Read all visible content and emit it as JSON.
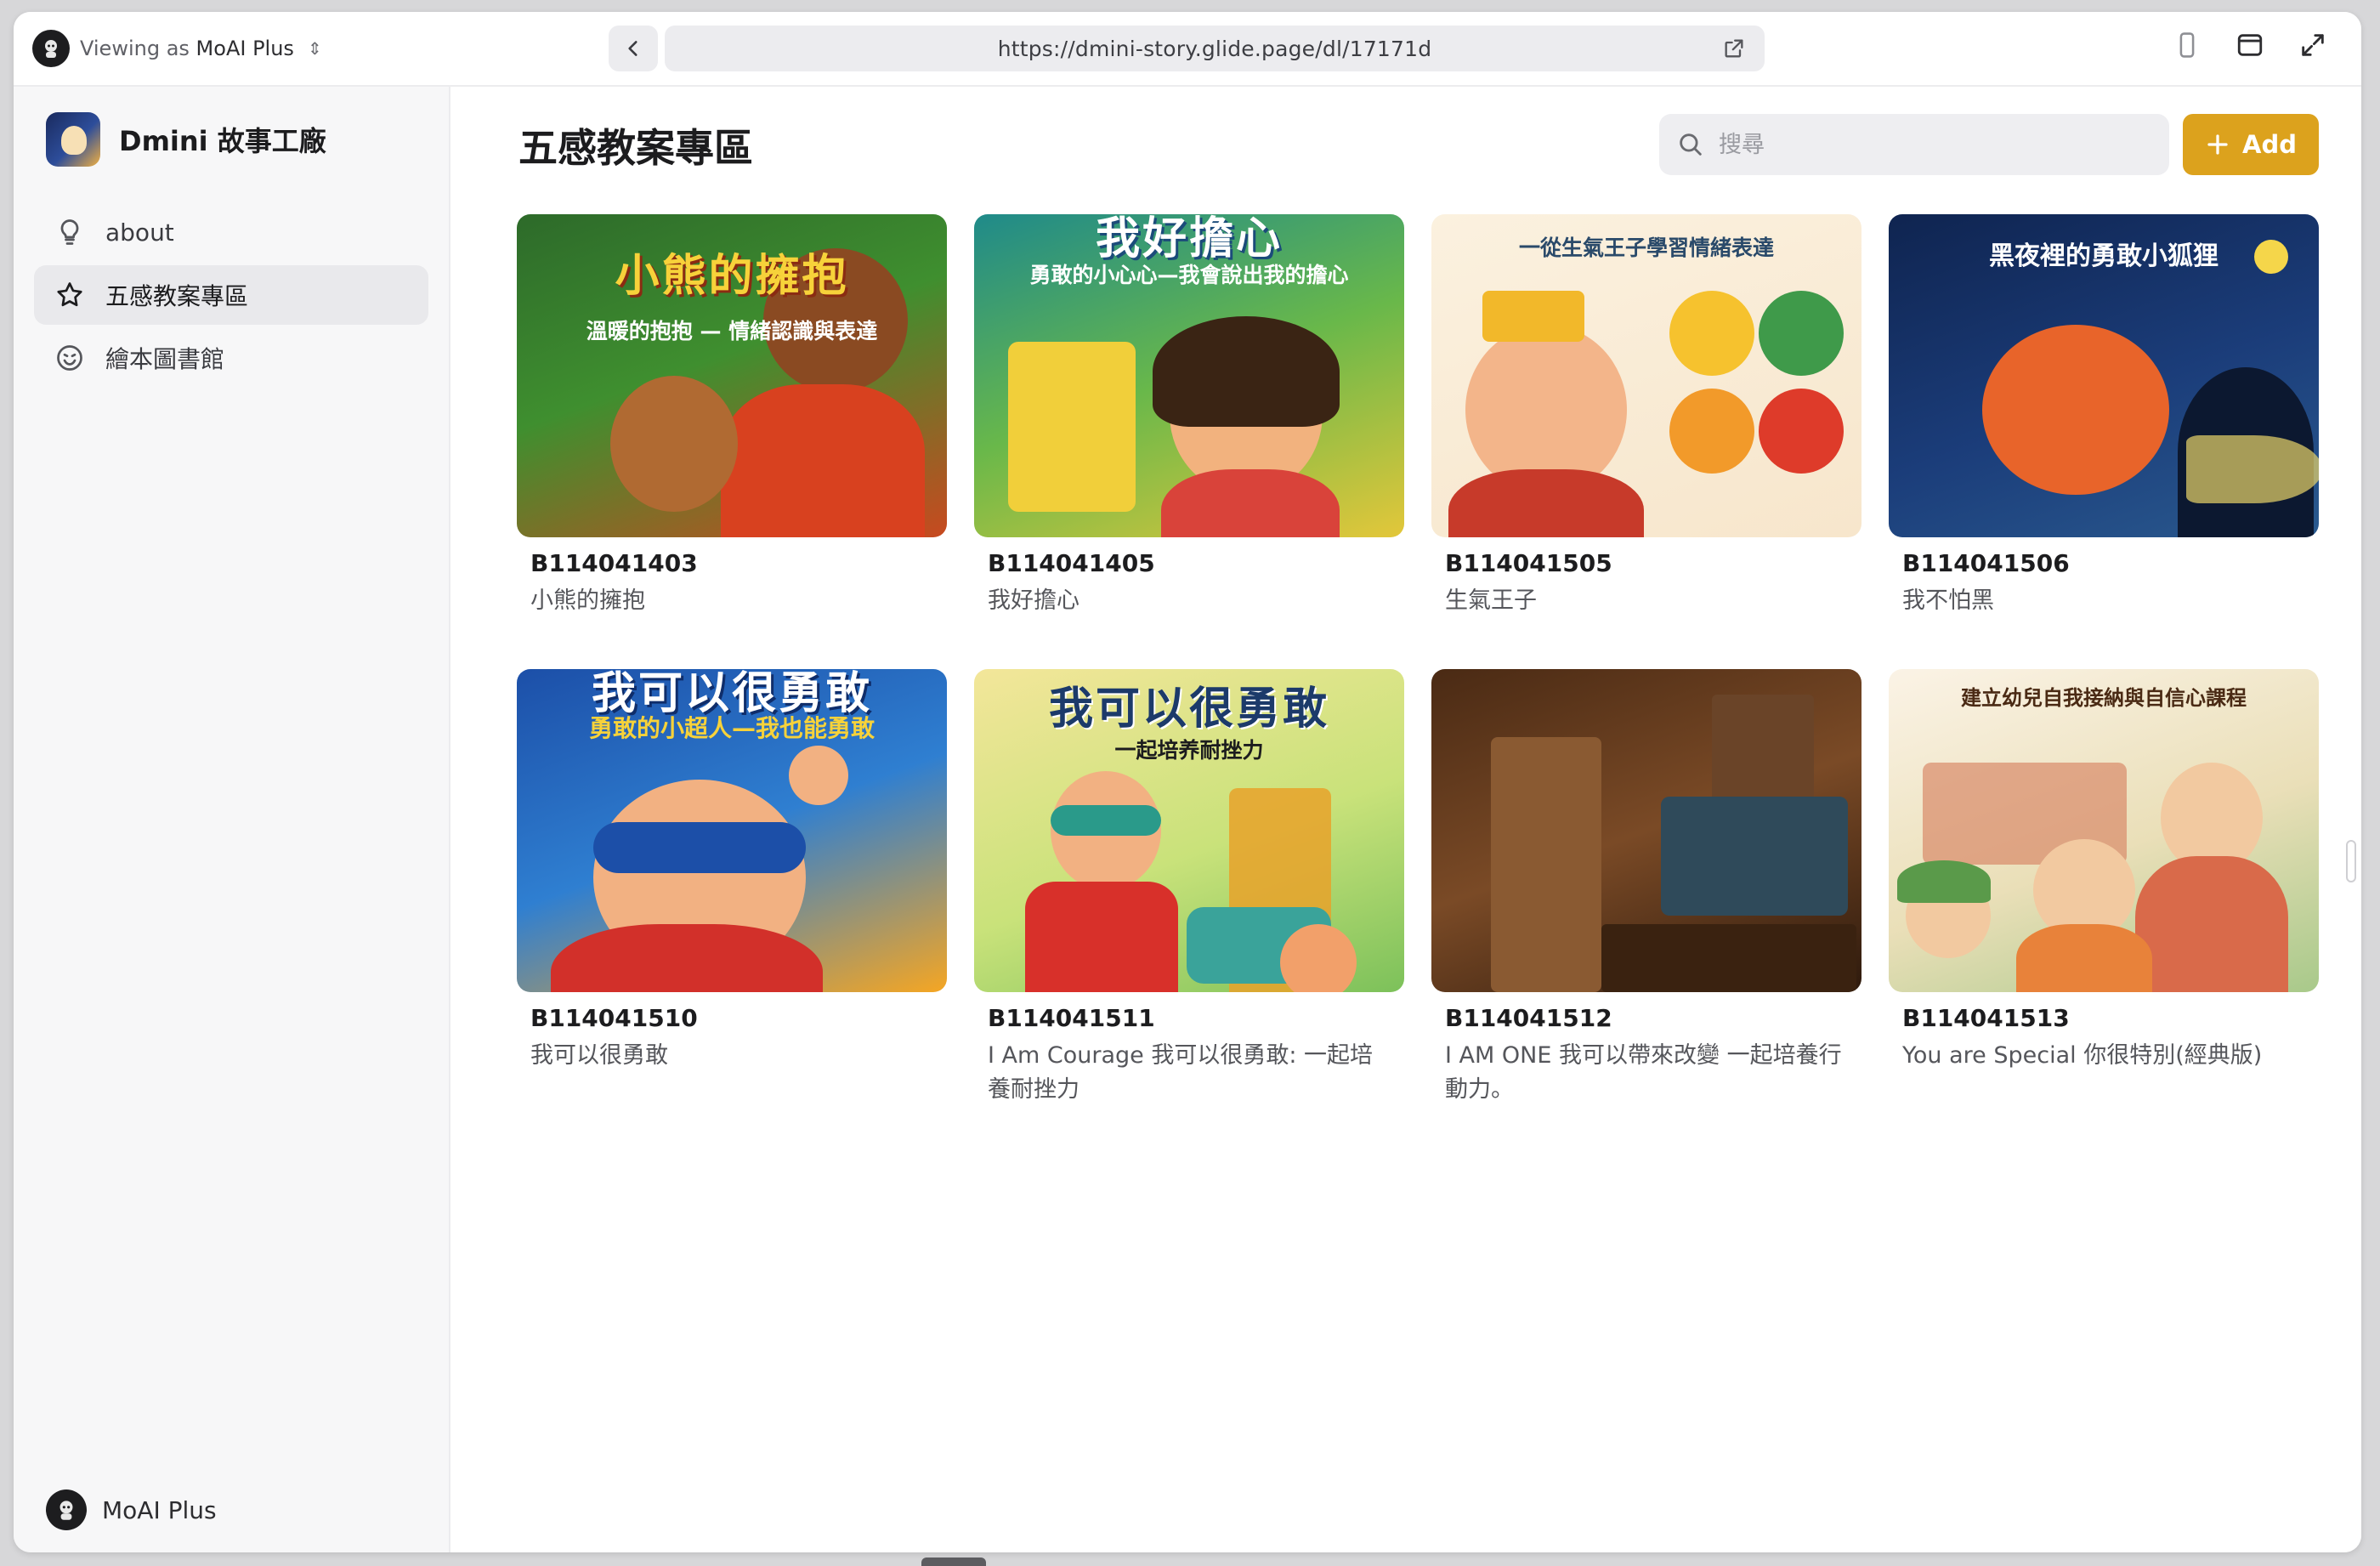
{
  "topbar": {
    "viewing_prefix": "Viewing as",
    "viewing_user": "MoAI Plus",
    "url": "https://dmini-story.glide.page/dl/17171d"
  },
  "sidebar": {
    "app_name": "Dmini 故事工廠",
    "items": [
      {
        "label": "about",
        "icon": "lightbulb-icon",
        "active": false
      },
      {
        "label": "五感教案專區",
        "icon": "star-icon",
        "active": true
      },
      {
        "label": "繪本圖書館",
        "icon": "smiley-icon",
        "active": false
      }
    ],
    "user_name": "MoAI Plus"
  },
  "main": {
    "title": "五感教案專區",
    "search_placeholder": "搜尋",
    "add_label": "Add",
    "accent": "#dca21d",
    "cards": [
      {
        "code": "B114041403",
        "title": "小熊的擁抱",
        "cover_title": "小熊的擁抱",
        "cover_sub": "溫暖的抱抱 — 情緒認識與表達"
      },
      {
        "code": "B114041405",
        "title": "我好擔心",
        "cover_title": "我好擔心",
        "cover_sub": "勇敢的小心心—我會說出我的擔心"
      },
      {
        "code": "B114041505",
        "title": "生氣王子",
        "cover_title": "",
        "cover_sub": "一從生氣王子學習情緒表達"
      },
      {
        "code": "B114041506",
        "title": "我不怕黑",
        "cover_title": "",
        "cover_sub": "黑夜裡的勇敢小狐狸"
      },
      {
        "code": "B114041510",
        "title": "我可以很勇敢",
        "cover_title": "我可以很勇敢",
        "cover_sub": "勇敢的小超人—我也能勇敢"
      },
      {
        "code": "B114041511",
        "title": "I Am Courage 我可以很勇敢: 一起培養耐挫力",
        "cover_title": "我可以很勇敢",
        "cover_sub": "一起培养耐挫力"
      },
      {
        "code": "B114041512",
        "title": "I AM ONE 我可以帶來改變 一起培養行動力。",
        "cover_title": "",
        "cover_sub": ""
      },
      {
        "code": "B114041513",
        "title": "You are Special 你很特別(經典版)",
        "cover_title": "",
        "cover_sub": "建立幼兒自我接納與自信心課程"
      }
    ]
  }
}
